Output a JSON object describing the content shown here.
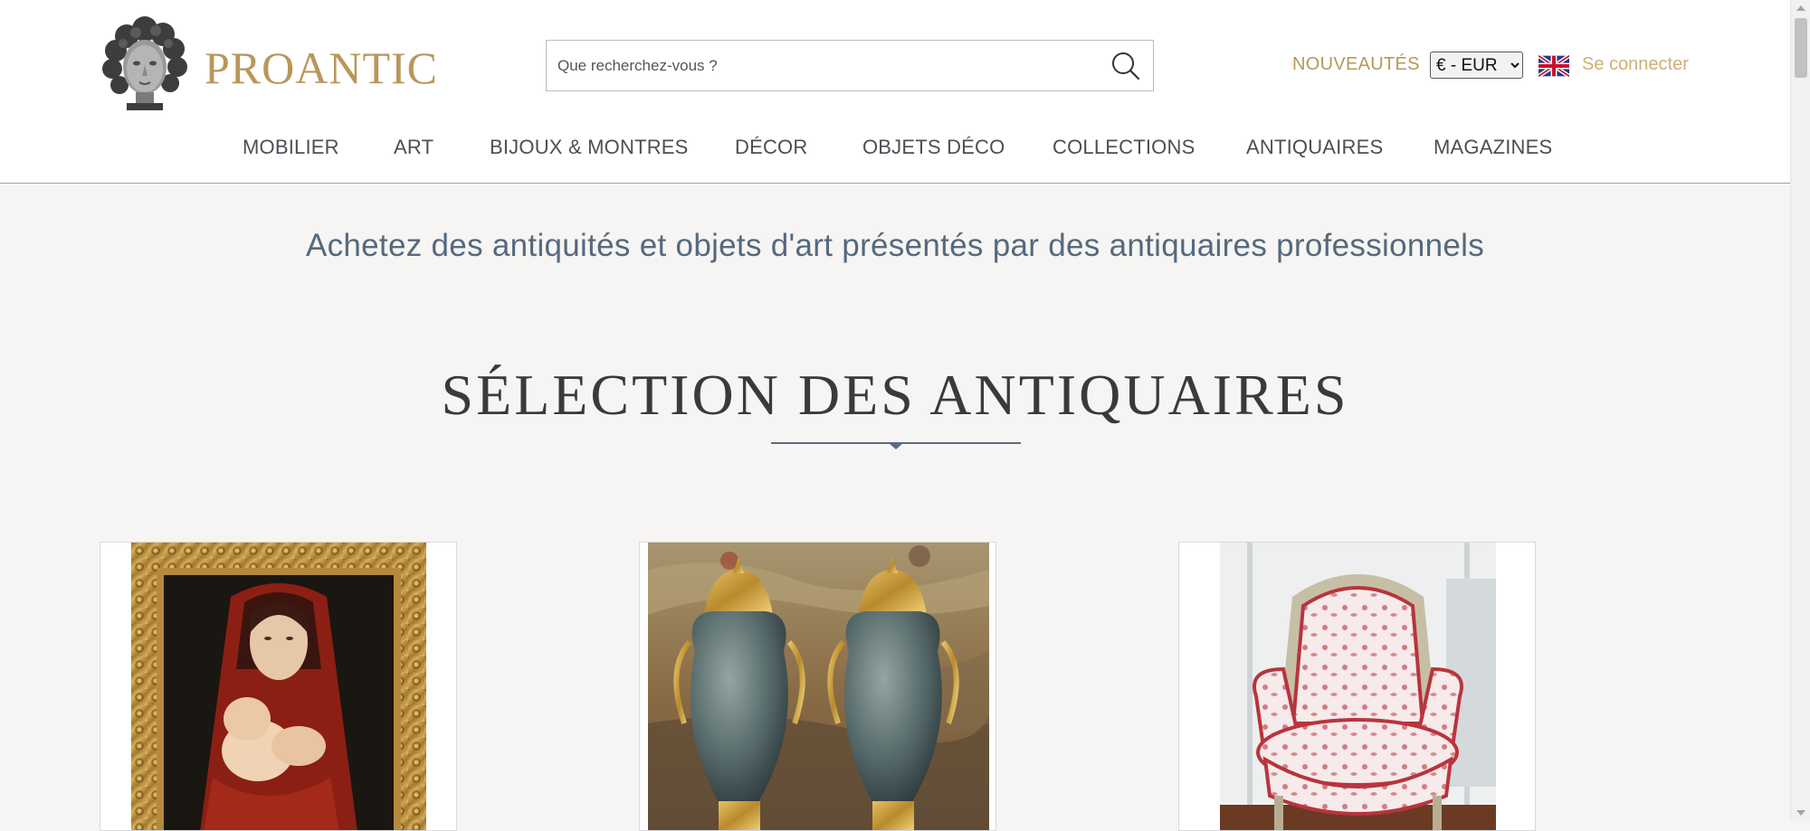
{
  "header": {
    "logo_text": "PROANTIC",
    "search": {
      "placeholder": "Que recherchez-vous ?",
      "value": ""
    },
    "nouveautes": "NOUVEAUTÉS",
    "currency": {
      "selected": "€ - EUR",
      "options": [
        "€ - EUR"
      ]
    },
    "language_flag": "uk-flag-icon",
    "login": "Se connecter"
  },
  "nav": {
    "items": [
      "MOBILIER",
      "ART",
      "BIJOUX & MONTRES",
      "DÉCOR",
      "OBJETS DÉCO",
      "COLLECTIONS",
      "ANTIQUAIRES",
      "MAGAZINES"
    ]
  },
  "main": {
    "tagline": "Achetez des antiquités et objets d'art présentés par des antiquaires professionnels",
    "section_title": "SÉLECTION DES ANTIQUAIRES",
    "cards": [
      {
        "image": "painting-madonna-and-child"
      },
      {
        "image": "pair-of-marble-vases-gilt-bronze"
      },
      {
        "image": "upholstered-bergere-armchair-toile"
      }
    ]
  },
  "colors": {
    "brand_gold": "#b9965a",
    "login_gold": "#cfae78",
    "tagline_blue": "#55697e",
    "background": "#f6f5f3"
  }
}
